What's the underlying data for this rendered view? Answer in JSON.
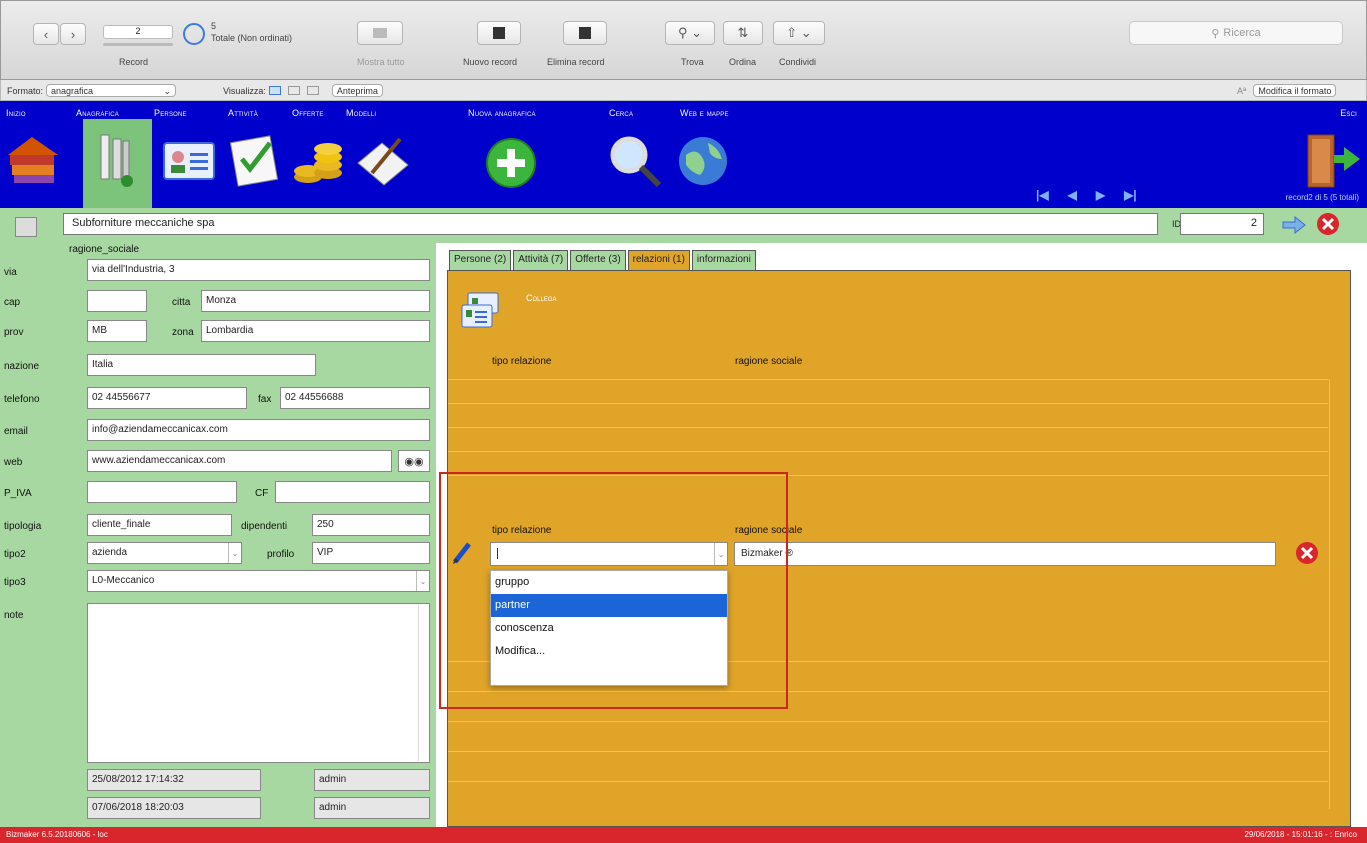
{
  "toolbar": {
    "record_number": "2",
    "record_label": "Record",
    "total_count": "5",
    "total_label": "Totale (Non ordinati)",
    "show_all_label": "Mostra tutto",
    "new_record_label": "Nuovo record",
    "delete_record_label": "Elimina record",
    "find_label": "Trova",
    "sort_label": "Ordina",
    "share_label": "Condividi",
    "search_placeholder": "Ricerca"
  },
  "formatbar": {
    "format_label": "Formato:",
    "format_value": "anagrafica",
    "view_label": "Visualizza:",
    "preview_label": "Anteprima",
    "font_glyph": "Aª",
    "edit_format_label": "Modifica il formato"
  },
  "nav": {
    "items": [
      {
        "label": "Inizio",
        "icon": "house-books-icon"
      },
      {
        "label": "Anagrafica",
        "icon": "rolodex-icon"
      },
      {
        "label": "Persone",
        "icon": "contact-card-icon"
      },
      {
        "label": "Attività",
        "icon": "checklist-icon"
      },
      {
        "label": "Offerte",
        "icon": "coins-icon"
      },
      {
        "label": "Modelli",
        "icon": "pencil-paper-icon"
      },
      {
        "label": "Nuova anagrafica",
        "icon": "add-icon"
      },
      {
        "label": "Cerca",
        "icon": "magnifier-icon"
      },
      {
        "label": "Web e mappe",
        "icon": "globe-icon"
      },
      {
        "label": "Esci",
        "icon": "exit-door-icon"
      }
    ],
    "record_info": "record2 di 5 (5 totali)"
  },
  "header": {
    "company_name": "Subforniture meccaniche spa",
    "id_label": "ID",
    "id_value": "2"
  },
  "form": {
    "ragione_sociale_label": "ragione_sociale",
    "via_label": "via",
    "via_value": "via dell'Industria, 3",
    "cap_label": "cap",
    "cap_value": "",
    "citta_label": "citta",
    "citta_value": "Monza",
    "prov_label": "prov",
    "prov_value": "MB",
    "zona_label": "zona",
    "zona_value": "Lombardia",
    "nazione_label": "nazione",
    "nazione_value": "Italia",
    "telefono_label": "telefono",
    "telefono_value": "02 44556677",
    "fax_label": "fax",
    "fax_value": "02 44556688",
    "email_label": "email",
    "email_value": "info@aziendameccanicax.com",
    "web_label": "web",
    "web_value": "www.aziendameccanicax.com",
    "piva_label": "P_IVA",
    "piva_value": "",
    "cf_label": "CF",
    "cf_value": "",
    "tipologia_label": "tipologia",
    "tipologia_value": "cliente_finale",
    "dipendenti_label": "dipendenti",
    "dipendenti_value": "250",
    "tipo2_label": "tipo2",
    "tipo2_value": "azienda",
    "profilo_label": "profilo",
    "profilo_value": "VIP",
    "tipo3_label": "tipo3",
    "tipo3_value": "L0-Meccanico",
    "note_label": "note",
    "note_value": "",
    "created_date": "25/08/2012 17:14:32",
    "created_user": "admin",
    "modified_date": "07/06/2018 18:20:03",
    "modified_user": "admin"
  },
  "tabs": [
    {
      "label": "Persone (2)"
    },
    {
      "label": "Attività (7)"
    },
    {
      "label": "Offerte (3)"
    },
    {
      "label": "relazioni (1)"
    },
    {
      "label": "informazioni"
    }
  ],
  "relazioni": {
    "collega_label": "Collega",
    "col_tipo": "tipo relazione",
    "col_ragione": "ragione sociale",
    "edit_tipo_label": "tipo relazione",
    "edit_ragione_label": "ragione sociale",
    "tipo_value": "",
    "ragione_value": "Bizmaker ®",
    "options": [
      "gruppo",
      "partner",
      "conoscenza",
      "Modifica..."
    ],
    "selected_option": "partner"
  },
  "status": {
    "left": "Bizmaker 6.5.20180606 - loc",
    "right": "29/06/2018 - 15:01:16 - : Enrico"
  },
  "colors": {
    "nav_blue": "#0000cc",
    "form_green": "#a8d8a2",
    "panel_orange": "#e0a428",
    "status_red": "#d9262c",
    "highlight_red": "#c8281e",
    "selection_blue": "#1b65d6"
  }
}
